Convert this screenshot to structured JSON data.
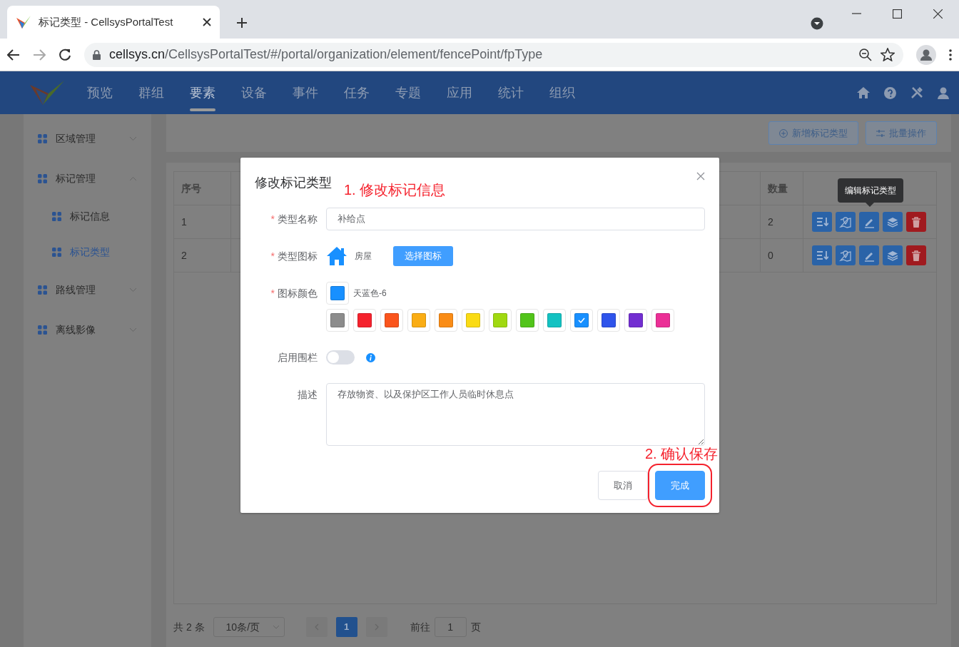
{
  "browser": {
    "tab_title": "标记类型 - CellsysPortalTest",
    "url": "cellsys.cn/CellsysPortalTest/#/portal/organization/element/fencePoint/fpType"
  },
  "nav": {
    "items": [
      {
        "label": "预览",
        "selected": false
      },
      {
        "label": "群组",
        "selected": false
      },
      {
        "label": "要素",
        "selected": true
      },
      {
        "label": "设备",
        "selected": false
      },
      {
        "label": "事件",
        "selected": false
      },
      {
        "label": "任务",
        "selected": false
      },
      {
        "label": "专题",
        "selected": false
      },
      {
        "label": "应用",
        "selected": false
      },
      {
        "label": "统计",
        "selected": false
      },
      {
        "label": "组织",
        "selected": false
      }
    ]
  },
  "sidebar": {
    "items": [
      {
        "label": "区域管理",
        "expanded": false
      },
      {
        "label": "标记管理",
        "expanded": true,
        "children": [
          {
            "label": "标记信息",
            "selected": false
          },
          {
            "label": "标记类型",
            "selected": true
          }
        ]
      },
      {
        "label": "路线管理",
        "expanded": false
      },
      {
        "label": "离线影像",
        "expanded": false
      }
    ]
  },
  "toolbar": {
    "buttons": [
      {
        "label": "新增标记类型",
        "kind": "add"
      },
      {
        "label": "批量操作",
        "kind": "batch"
      }
    ]
  },
  "table": {
    "columns": [
      "序号",
      "数量"
    ],
    "rows": [
      {
        "index": "1",
        "count": "2"
      },
      {
        "index": "2",
        "count": "0"
      }
    ],
    "tooltip": "编辑标记类型"
  },
  "pagination": {
    "total": "共 2 条",
    "page_size": "10条/页",
    "pages": [
      {
        "label": "1",
        "selected": true
      }
    ],
    "goto_label": "前往",
    "goto_value": "1",
    "page_unit": "页"
  },
  "dialog": {
    "title": "修改标记类型",
    "fields": [
      {
        "kind": "text",
        "label": "类型名称",
        "required_mark": "*",
        "value": "补给点"
      },
      {
        "kind": "icon",
        "label": "类型图标",
        "required_mark": "*",
        "icon_name": "房屋",
        "button": "选择图标"
      },
      {
        "kind": "color",
        "label": "图标颜色",
        "required_mark": "*",
        "color_name": "天蓝色-6",
        "swatches": [
          {
            "color": "#8c8c8c",
            "selected": false
          },
          {
            "color": "#f5222d",
            "selected": false
          },
          {
            "color": "#fa541c",
            "selected": false
          },
          {
            "color": "#faad14",
            "selected": false
          },
          {
            "color": "#fa8c16",
            "selected": false
          },
          {
            "color": "#fadb14",
            "selected": false
          },
          {
            "color": "#a0d911",
            "selected": false
          },
          {
            "color": "#52c41a",
            "selected": false
          },
          {
            "color": "#13c2c2",
            "selected": false
          },
          {
            "color": "#1890ff",
            "selected": true
          },
          {
            "color": "#2f54eb",
            "selected": false
          },
          {
            "color": "#722ed1",
            "selected": false
          },
          {
            "color": "#eb2f96",
            "selected": false
          }
        ]
      },
      {
        "kind": "switch",
        "label": "启用围栏",
        "on": false
      },
      {
        "kind": "textarea",
        "label": "描述",
        "value": "存放物资、以及保护区工作人员临时休息点"
      }
    ],
    "buttons": [
      {
        "label": "取消",
        "kind": "default",
        "highlighted": false
      },
      {
        "label": "完成",
        "kind": "primary",
        "highlighted": true
      }
    ],
    "annotations": [
      {
        "text": "1. 修改标记信息"
      },
      {
        "text": "2. 确认保存"
      }
    ]
  }
}
